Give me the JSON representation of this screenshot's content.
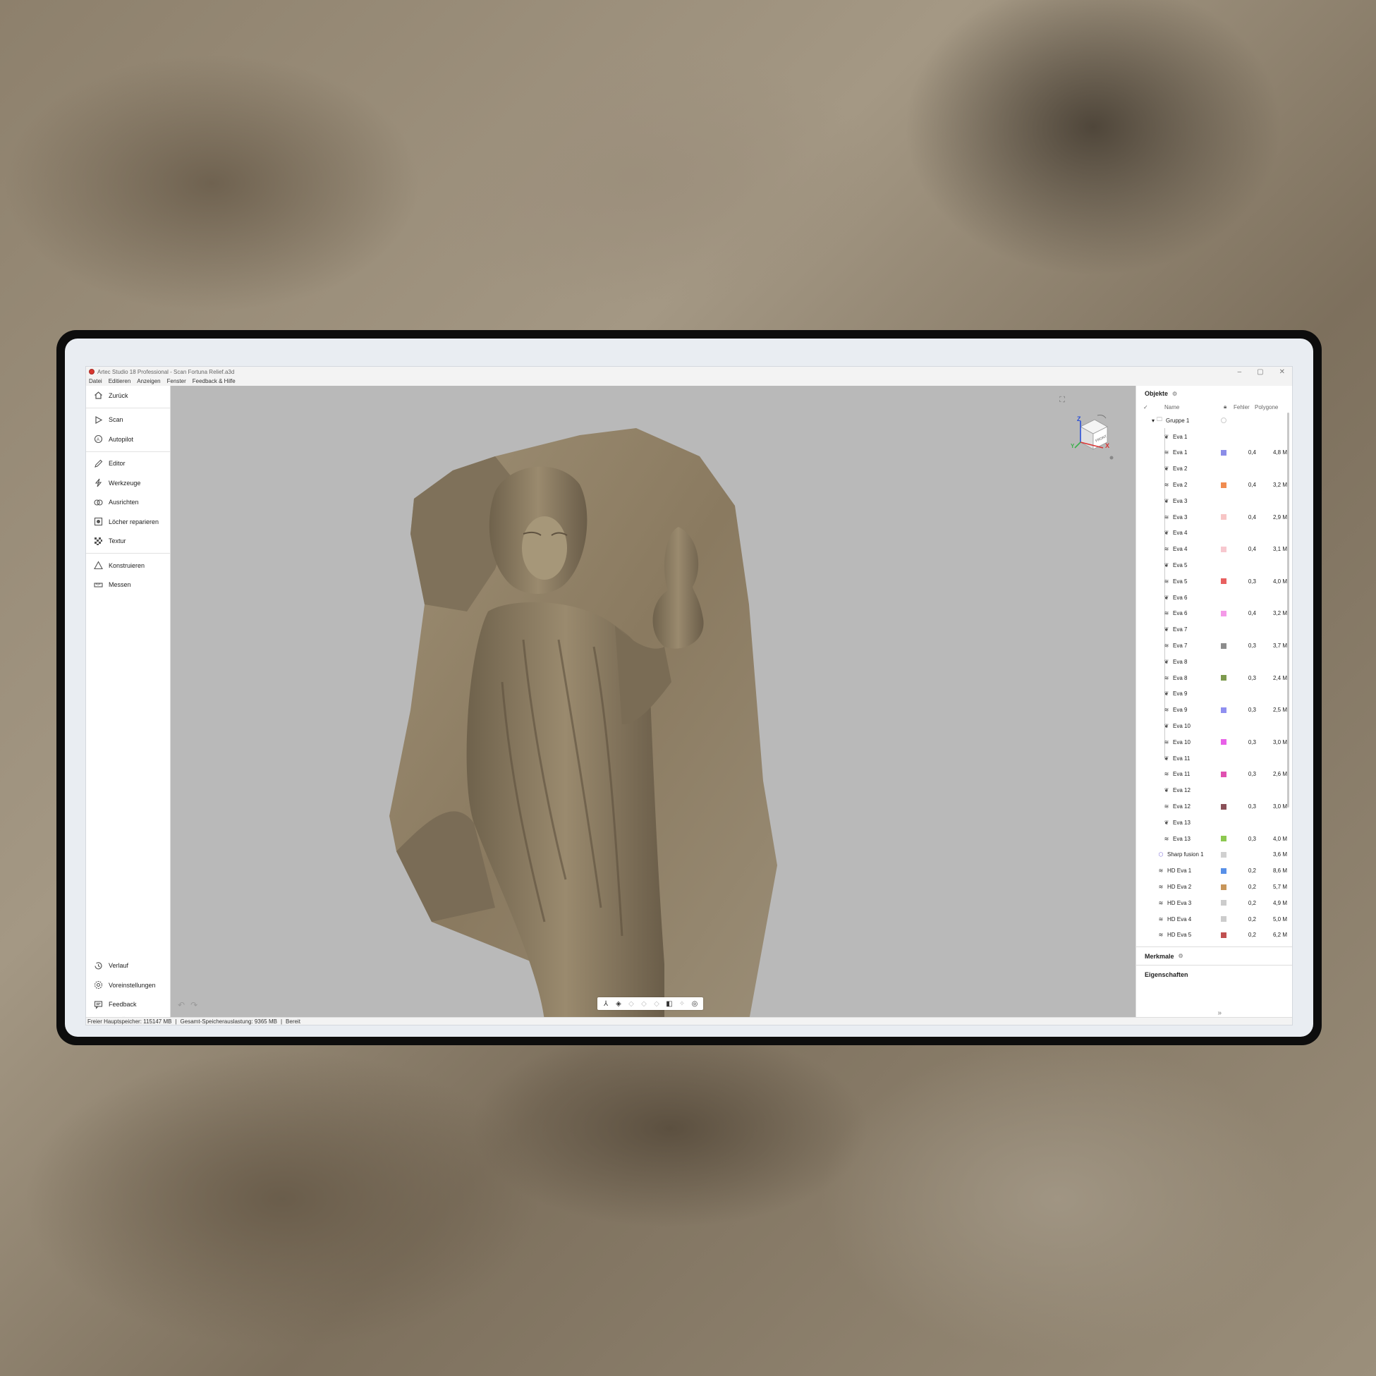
{
  "window": {
    "title": "Artec Studio 18 Professional - Scan Fortuna Relief.a3d",
    "controls": [
      "–",
      "▢",
      "✕"
    ]
  },
  "menu": [
    "Datei",
    "Editieren",
    "Anzeigen",
    "Fenster",
    "Feedback & Hilfe"
  ],
  "sidebar": {
    "back": "Zurück",
    "group1": [
      {
        "label": "Scan",
        "icon": "play-icon"
      },
      {
        "label": "Autopilot",
        "icon": "autopilot-icon"
      }
    ],
    "group2": [
      {
        "label": "Editor",
        "icon": "pencil-icon"
      },
      {
        "label": "Werkzeuge",
        "icon": "lightning-icon"
      },
      {
        "label": "Ausrichten",
        "icon": "align-icon"
      },
      {
        "label": "Löcher reparieren",
        "icon": "hole-fill-icon"
      },
      {
        "label": "Textur",
        "icon": "texture-icon"
      }
    ],
    "group3": [
      {
        "label": "Konstruieren",
        "icon": "triangle-icon"
      },
      {
        "label": "Messen",
        "icon": "ruler-icon"
      }
    ],
    "bottom": [
      {
        "label": "Verlauf",
        "icon": "history-icon"
      },
      {
        "label": "Voreinstellungen",
        "icon": "gear-icon"
      },
      {
        "label": "Feedback",
        "icon": "feedback-icon"
      }
    ],
    "collapse": "«"
  },
  "viewcube": {
    "face": "FRONT",
    "x_label": "X",
    "y_label": "Y",
    "z_label": "Z"
  },
  "objects_panel": {
    "title": "Objekte",
    "columns": {
      "name": "Name",
      "error": "Fehler",
      "polygons": "Polygone"
    },
    "rows": [
      {
        "name": "Gruppe 1",
        "icon": "folder-icon",
        "indent": 1,
        "color": "",
        "err": "",
        "poly": ""
      },
      {
        "name": "Eva 1",
        "icon": "scan-icon",
        "indent": 3,
        "color": "",
        "err": "",
        "poly": ""
      },
      {
        "name": "Eva 1",
        "icon": "layers-icon",
        "indent": 3,
        "color": "#8b8de8",
        "err": "0,4",
        "poly": "4,8 M"
      },
      {
        "name": "Eva 2",
        "icon": "scan-icon",
        "indent": 3,
        "color": "",
        "err": "",
        "poly": ""
      },
      {
        "name": "Eva 2",
        "icon": "layers-icon",
        "indent": 3,
        "color": "#f08c50",
        "err": "0,4",
        "poly": "3,2 M"
      },
      {
        "name": "Eva 3",
        "icon": "scan-icon",
        "indent": 3,
        "color": "",
        "err": "",
        "poly": ""
      },
      {
        "name": "Eva 3",
        "icon": "layers-icon",
        "indent": 3,
        "color": "#f7c5c5",
        "err": "0,4",
        "poly": "2,9 M"
      },
      {
        "name": "Eva 4",
        "icon": "scan-icon",
        "indent": 3,
        "color": "",
        "err": "",
        "poly": ""
      },
      {
        "name": "Eva 4",
        "icon": "layers-icon",
        "indent": 3,
        "color": "#f7c8cf",
        "err": "0,4",
        "poly": "3,1 M"
      },
      {
        "name": "Eva 5",
        "icon": "scan-icon",
        "indent": 3,
        "color": "",
        "err": "",
        "poly": ""
      },
      {
        "name": "Eva 5",
        "icon": "layers-icon",
        "indent": 3,
        "color": "#e86060",
        "err": "0,3",
        "poly": "4,0 M"
      },
      {
        "name": "Eva 6",
        "icon": "scan-icon",
        "indent": 3,
        "color": "",
        "err": "",
        "poly": ""
      },
      {
        "name": "Eva 6",
        "icon": "layers-icon",
        "indent": 3,
        "color": "#f49ae8",
        "err": "0,4",
        "poly": "3,2 M"
      },
      {
        "name": "Eva 7",
        "icon": "scan-icon",
        "indent": 3,
        "color": "",
        "err": "",
        "poly": ""
      },
      {
        "name": "Eva 7",
        "icon": "layers-icon",
        "indent": 3,
        "color": "#8c8c8c",
        "err": "0,3",
        "poly": "3,7 M"
      },
      {
        "name": "Eva 8",
        "icon": "scan-icon",
        "indent": 3,
        "color": "",
        "err": "",
        "poly": ""
      },
      {
        "name": "Eva 8",
        "icon": "layers-icon",
        "indent": 3,
        "color": "#7d9a4e",
        "err": "0,3",
        "poly": "2,4 M"
      },
      {
        "name": "Eva 9",
        "icon": "scan-icon",
        "indent": 3,
        "color": "",
        "err": "",
        "poly": ""
      },
      {
        "name": "Eva 9",
        "icon": "layers-icon",
        "indent": 3,
        "color": "#8f8ff0",
        "err": "0,3",
        "poly": "2,5 M"
      },
      {
        "name": "Eva 10",
        "icon": "scan-icon",
        "indent": 3,
        "color": "",
        "err": "",
        "poly": ""
      },
      {
        "name": "Eva 10",
        "icon": "layers-icon",
        "indent": 3,
        "color": "#e860e8",
        "err": "0,3",
        "poly": "3,0 M"
      },
      {
        "name": "Eva 11",
        "icon": "scan-icon",
        "indent": 3,
        "color": "",
        "err": "",
        "poly": ""
      },
      {
        "name": "Eva 11",
        "icon": "layers-icon",
        "indent": 3,
        "color": "#e050b0",
        "err": "0,3",
        "poly": "2,6 M"
      },
      {
        "name": "Eva 12",
        "icon": "scan-icon",
        "indent": 3,
        "color": "",
        "err": "",
        "poly": ""
      },
      {
        "name": "Eva 12",
        "icon": "layers-icon",
        "indent": 3,
        "color": "#8a5058",
        "err": "0,3",
        "poly": "3,0 M"
      },
      {
        "name": "Eva 13",
        "icon": "scan-icon",
        "indent": 3,
        "color": "",
        "err": "",
        "poly": ""
      },
      {
        "name": "Eva 13",
        "icon": "layers-icon",
        "indent": 3,
        "color": "#8cc850",
        "err": "0,3",
        "poly": "4,0 M"
      },
      {
        "name": "Sharp fusion 1",
        "icon": "fusion-icon",
        "indent": 2,
        "color": "#d0d0d0",
        "err": "",
        "poly": "3,6 M"
      },
      {
        "name": "HD Eva 1",
        "icon": "layers-icon",
        "indent": 2,
        "color": "#5890e8",
        "err": "0,2",
        "poly": "8,6 M"
      },
      {
        "name": "HD Eva 2",
        "icon": "layers-icon",
        "indent": 2,
        "color": "#c8965a",
        "err": "0,2",
        "poly": "5,7 M"
      },
      {
        "name": "HD Eva 3",
        "icon": "layers-icon",
        "indent": 2,
        "color": "#cccccc",
        "err": "0,2",
        "poly": "4,9 M"
      },
      {
        "name": "HD Eva 4",
        "icon": "layers-icon",
        "indent": 2,
        "color": "#cccccc",
        "err": "0,2",
        "poly": "5,0 M"
      },
      {
        "name": "HD Eva 5",
        "icon": "layers-icon",
        "indent": 2,
        "color": "#c05050",
        "err": "0,2",
        "poly": "6,2 M"
      }
    ]
  },
  "features_panel": {
    "title": "Merkmale"
  },
  "properties_panel": {
    "title": "Eigenschaften"
  },
  "panel_expand": "»",
  "status": {
    "memory": "Freier Hauptspeicher: 115147 MB",
    "sep": "|",
    "usage": "Gesamt-Speicherauslastung: 9365 MB",
    "state": "Bereit"
  }
}
